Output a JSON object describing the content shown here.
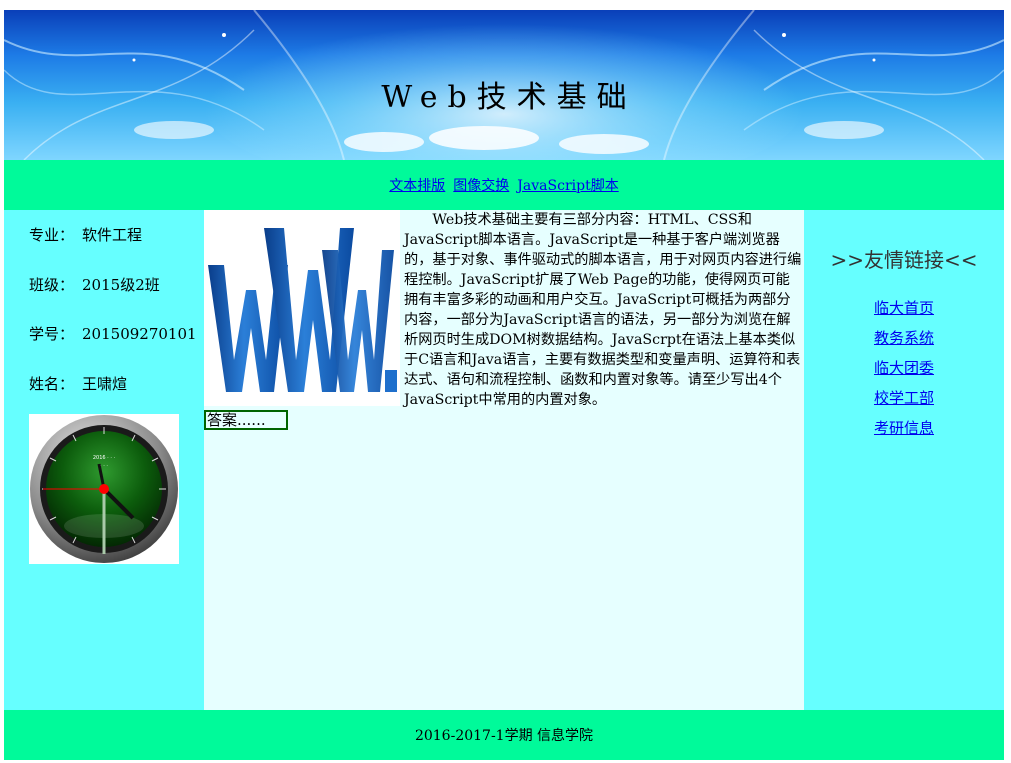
{
  "banner": {
    "title": "Web技术基础"
  },
  "nav": {
    "links": [
      {
        "label": "文本排版"
      },
      {
        "label": "图像交换"
      },
      {
        "label": "JavaScript脚本"
      }
    ]
  },
  "left": {
    "info": [
      {
        "label": "专业：",
        "value": "软件工程"
      },
      {
        "label": "班级：",
        "value": "2015级2班"
      },
      {
        "label": "学号：",
        "value": "201509270101"
      },
      {
        "label": "姓名：",
        "value": "王啸煊"
      }
    ]
  },
  "center": {
    "paragraph": "Web技术基础主要有三部分内容：HTML、CSS和JavaScript脚本语言。JavaScript是一种基于客户端浏览器的，基于对象、事件驱动式的脚本语言，用于对网页内容进行编程控制。JavaScript扩展了Web Page的功能，使得网页可能拥有丰富多彩的动画和用户交互。JavaScript可概括为两部分内容，一部分为JavaScript语言的语法，另一部分为浏览在解析网页时生成DOM树数据结构。JavaScrpt在语法上基本类似于C语言和Java语言，主要有数据类型和变量声明、运算符和表达式、语句和流程控制、函数和内置对象等。请至少写出4个JavaScript中常用的内置对象。",
    "answer_value": "答案......"
  },
  "right": {
    "title": ">>友情链接<<",
    "links": [
      {
        "label": "临大首页"
      },
      {
        "label": "教务系统"
      },
      {
        "label": "临大团委"
      },
      {
        "label": "校学工部"
      },
      {
        "label": "考研信息"
      }
    ]
  },
  "footer": {
    "text": "2016-2017-1学期 信息学院"
  },
  "colors": {
    "nav_bg": "#00fa9a",
    "side_bg": "#66ffff",
    "content_bg": "#e6ffff",
    "link": "#0000ee",
    "answer_border": "#006400"
  }
}
